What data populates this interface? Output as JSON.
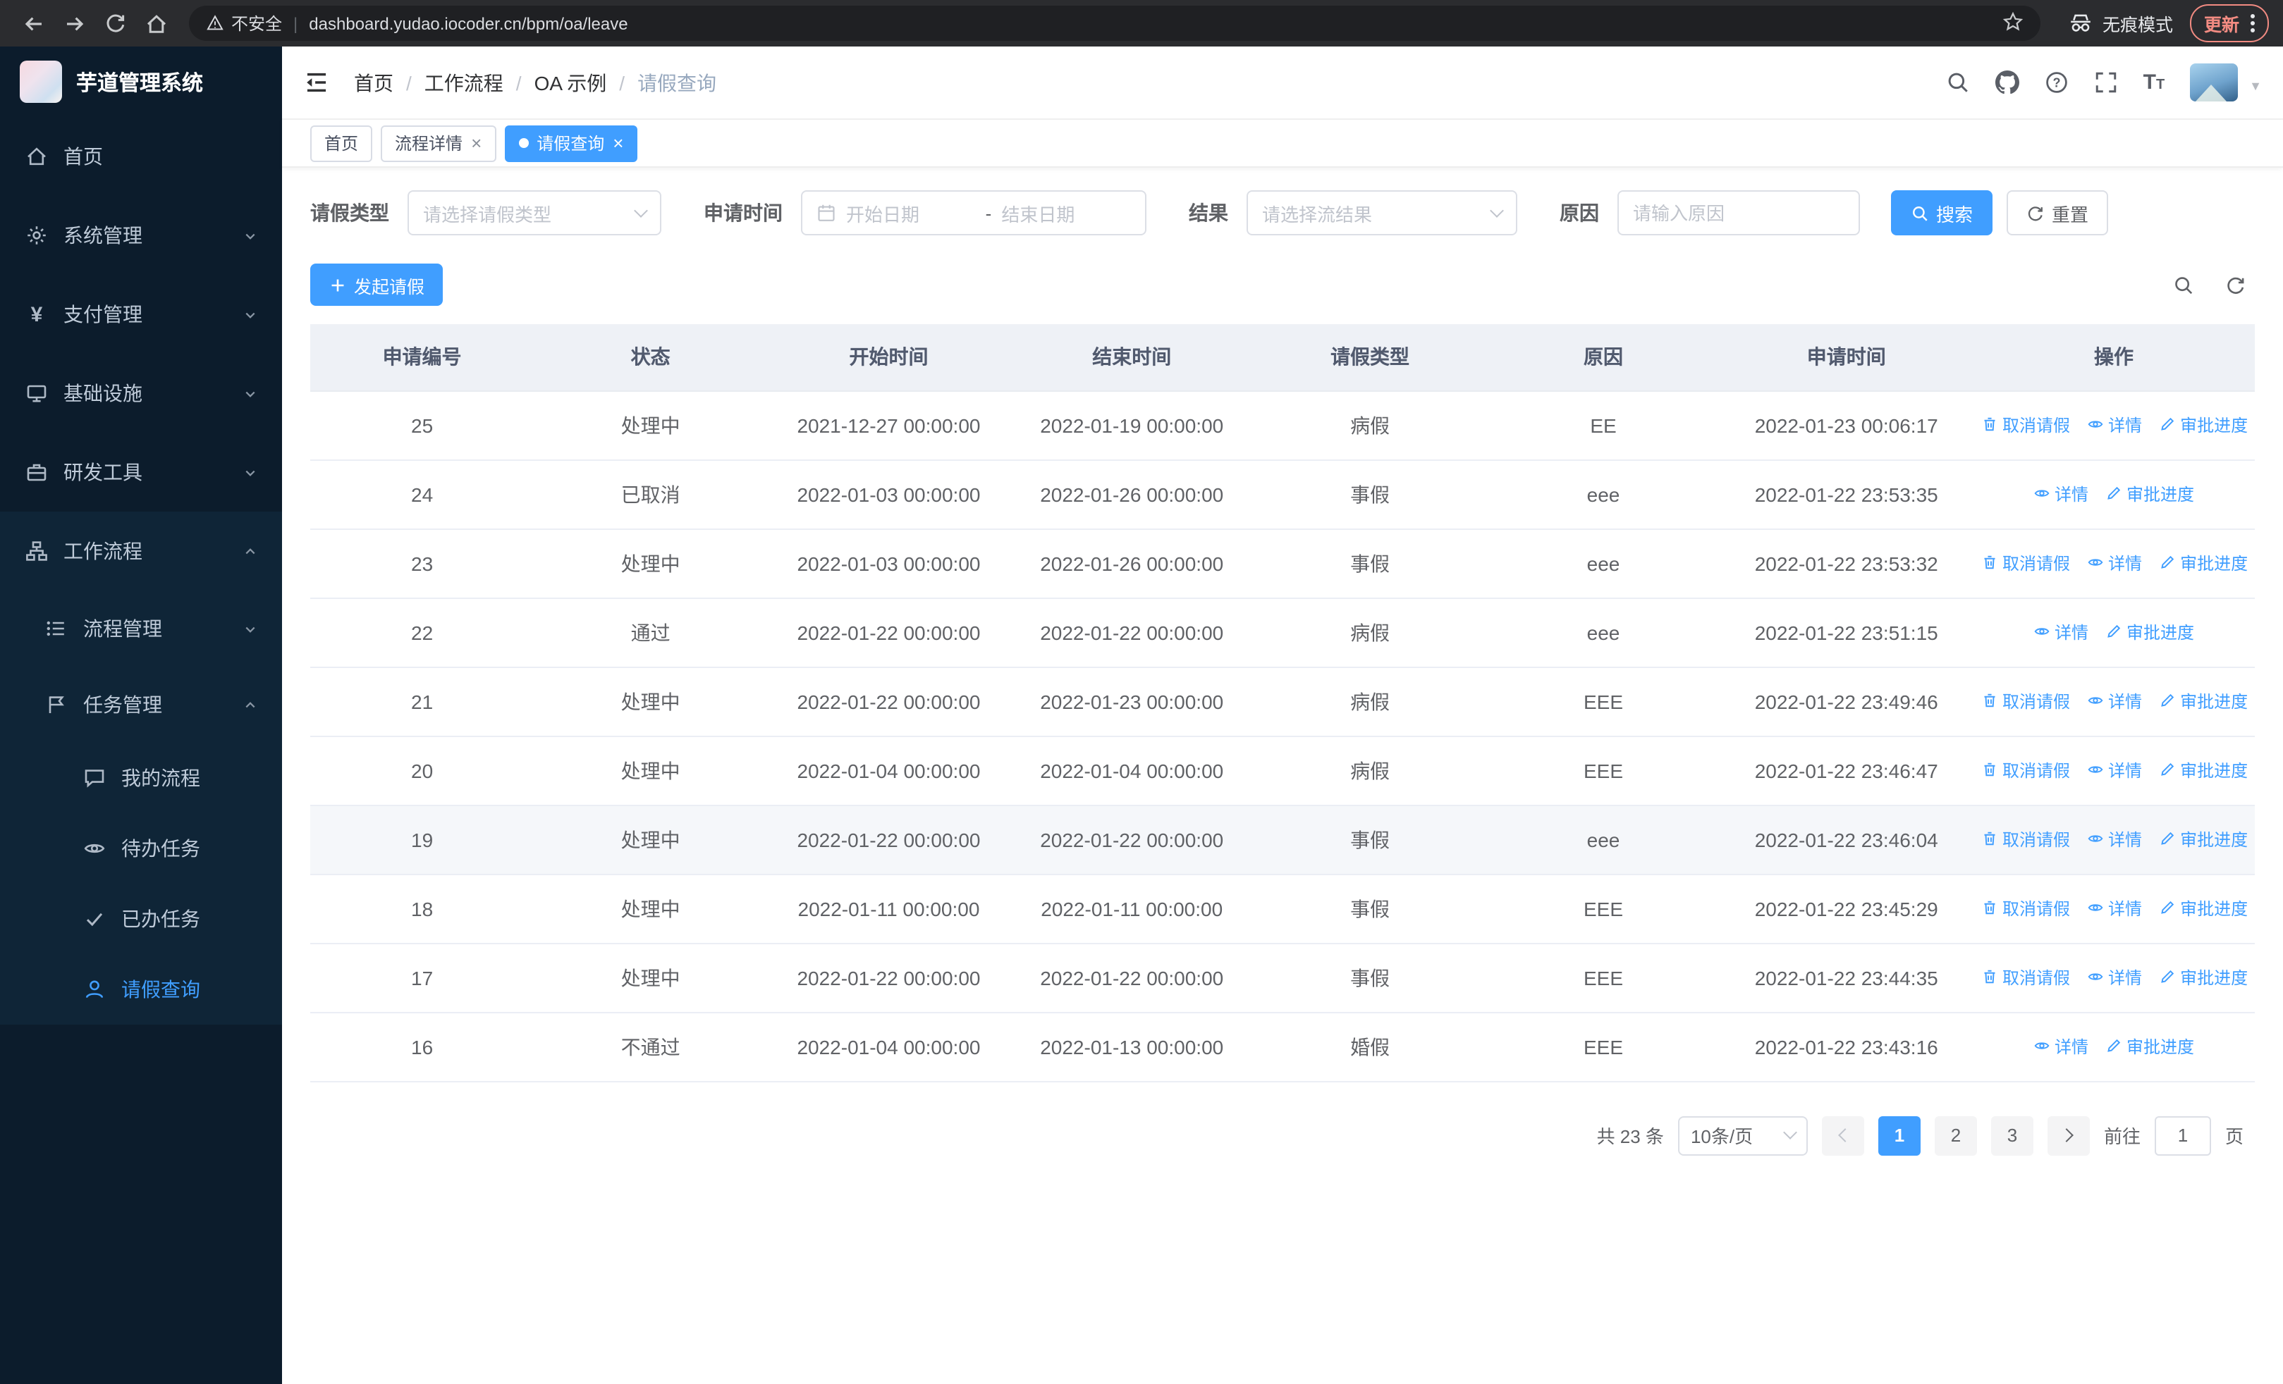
{
  "browser": {
    "security_label": "不安全",
    "url": "dashboard.yudao.iocoder.cn/bpm/oa/leave",
    "incognito_label": "无痕模式",
    "update_label": "更新"
  },
  "sidebar": {
    "title": "芋道管理系统",
    "home": "首页",
    "system": "系统管理",
    "payment": "支付管理",
    "infra": "基础设施",
    "devtools": "研发工具",
    "workflow": "工作流程",
    "process_mgmt": "流程管理",
    "task_mgmt": "任务管理",
    "my_process": "我的流程",
    "todo_tasks": "待办任务",
    "done_tasks": "已办任务",
    "leave_query": "请假查询"
  },
  "breadcrumb": {
    "items": [
      "首页",
      "工作流程",
      "OA 示例",
      "请假查询"
    ]
  },
  "tabs": [
    {
      "label": "首页"
    },
    {
      "label": "流程详情"
    },
    {
      "label": "请假查询"
    }
  ],
  "filters": {
    "leave_type_label": "请假类型",
    "leave_type_placeholder": "请选择请假类型",
    "apply_time_label": "申请时间",
    "start_date_placeholder": "开始日期",
    "range_separator": "-",
    "end_date_placeholder": "结束日期",
    "result_label": "结果",
    "result_placeholder": "请选择流结果",
    "reason_label": "原因",
    "reason_placeholder": "请输入原因",
    "search_label": "搜索",
    "reset_label": "重置"
  },
  "toolbar": {
    "create_label": "发起请假"
  },
  "table": {
    "headers": [
      "申请编号",
      "状态",
      "开始时间",
      "结束时间",
      "请假类型",
      "原因",
      "申请时间",
      "操作"
    ],
    "op_labels": {
      "cancel": "取消请假",
      "detail": "详情",
      "progress": "审批进度"
    },
    "rows": [
      {
        "id": "25",
        "status": "处理中",
        "start": "2021-12-27 00:00:00",
        "end": "2022-01-19 00:00:00",
        "type": "病假",
        "reason": "EE",
        "applied": "2022-01-23 00:06:17",
        "ops": [
          "cancel",
          "detail",
          "progress"
        ],
        "highlighted": false
      },
      {
        "id": "24",
        "status": "已取消",
        "start": "2022-01-03 00:00:00",
        "end": "2022-01-26 00:00:00",
        "type": "事假",
        "reason": "eee",
        "applied": "2022-01-22 23:53:35",
        "ops": [
          "detail",
          "progress"
        ],
        "highlighted": false
      },
      {
        "id": "23",
        "status": "处理中",
        "start": "2022-01-03 00:00:00",
        "end": "2022-01-26 00:00:00",
        "type": "事假",
        "reason": "eee",
        "applied": "2022-01-22 23:53:32",
        "ops": [
          "cancel",
          "detail",
          "progress"
        ],
        "highlighted": false
      },
      {
        "id": "22",
        "status": "通过",
        "start": "2022-01-22 00:00:00",
        "end": "2022-01-22 00:00:00",
        "type": "病假",
        "reason": "eee",
        "applied": "2022-01-22 23:51:15",
        "ops": [
          "detail",
          "progress"
        ],
        "highlighted": false
      },
      {
        "id": "21",
        "status": "处理中",
        "start": "2022-01-22 00:00:00",
        "end": "2022-01-23 00:00:00",
        "type": "病假",
        "reason": "EEE",
        "applied": "2022-01-22 23:49:46",
        "ops": [
          "cancel",
          "detail",
          "progress"
        ],
        "highlighted": false
      },
      {
        "id": "20",
        "status": "处理中",
        "start": "2022-01-04 00:00:00",
        "end": "2022-01-04 00:00:00",
        "type": "病假",
        "reason": "EEE",
        "applied": "2022-01-22 23:46:47",
        "ops": [
          "cancel",
          "detail",
          "progress"
        ],
        "highlighted": false
      },
      {
        "id": "19",
        "status": "处理中",
        "start": "2022-01-22 00:00:00",
        "end": "2022-01-22 00:00:00",
        "type": "事假",
        "reason": "eee",
        "applied": "2022-01-22 23:46:04",
        "ops": [
          "cancel",
          "detail",
          "progress"
        ],
        "highlighted": true
      },
      {
        "id": "18",
        "status": "处理中",
        "start": "2022-01-11 00:00:00",
        "end": "2022-01-11 00:00:00",
        "type": "事假",
        "reason": "EEE",
        "applied": "2022-01-22 23:45:29",
        "ops": [
          "cancel",
          "detail",
          "progress"
        ],
        "highlighted": false
      },
      {
        "id": "17",
        "status": "处理中",
        "start": "2022-01-22 00:00:00",
        "end": "2022-01-22 00:00:00",
        "type": "事假",
        "reason": "EEE",
        "applied": "2022-01-22 23:44:35",
        "ops": [
          "cancel",
          "detail",
          "progress"
        ],
        "highlighted": false
      },
      {
        "id": "16",
        "status": "不通过",
        "start": "2022-01-04 00:00:00",
        "end": "2022-01-13 00:00:00",
        "type": "婚假",
        "reason": "EEE",
        "applied": "2022-01-22 23:43:16",
        "ops": [
          "detail",
          "progress"
        ],
        "highlighted": false
      }
    ]
  },
  "pagination": {
    "total_label": "共 23 条",
    "page_size": "10条/页",
    "pages": [
      "1",
      "2",
      "3"
    ],
    "active_page": "1",
    "goto_label": "前往",
    "goto_value": "1",
    "goto_unit": "页"
  },
  "colors": {
    "accent": "#409eff",
    "sidebar_bg": "#0c1c2c",
    "sidebar_submenu_bg": "#0f2537",
    "chrome_bg": "#2b2c2f",
    "update_badge": "#f28b82"
  }
}
